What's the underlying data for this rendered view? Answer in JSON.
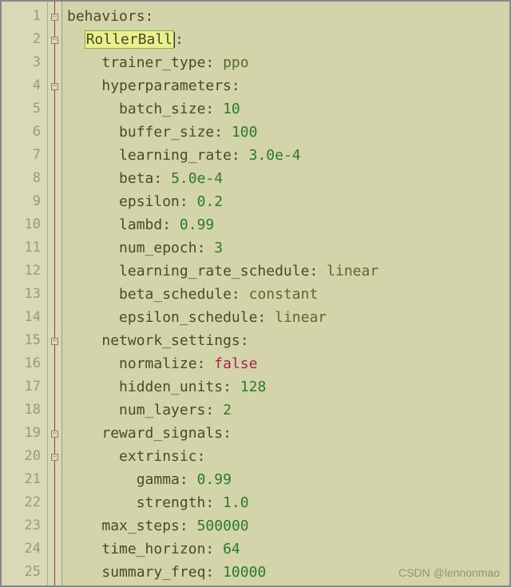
{
  "watermark": "CSDN @lennonmao",
  "lines": [
    {
      "n": 1,
      "indent": 0,
      "fold": "open",
      "key": "behaviors",
      "val": "",
      "type": "none"
    },
    {
      "n": 2,
      "indent": 1,
      "fold": "open",
      "key": "RollerBall",
      "hl": true,
      "cursor": true,
      "val": "",
      "type": "none"
    },
    {
      "n": 3,
      "indent": 2,
      "fold": "",
      "key": "trainer_type",
      "val": "ppo",
      "type": "str"
    },
    {
      "n": 4,
      "indent": 2,
      "fold": "open",
      "key": "hyperparameters",
      "val": "",
      "type": "none"
    },
    {
      "n": 5,
      "indent": 3,
      "fold": "",
      "key": "batch_size",
      "val": "10",
      "type": "num"
    },
    {
      "n": 6,
      "indent": 3,
      "fold": "",
      "key": "buffer_size",
      "val": "100",
      "type": "num"
    },
    {
      "n": 7,
      "indent": 3,
      "fold": "",
      "key": "learning_rate",
      "val": "3.0e-4",
      "type": "num"
    },
    {
      "n": 8,
      "indent": 3,
      "fold": "",
      "key": "beta",
      "val": "5.0e-4",
      "type": "num"
    },
    {
      "n": 9,
      "indent": 3,
      "fold": "",
      "key": "epsilon",
      "val": "0.2",
      "type": "num"
    },
    {
      "n": 10,
      "indent": 3,
      "fold": "",
      "key": "lambd",
      "val": "0.99",
      "type": "num"
    },
    {
      "n": 11,
      "indent": 3,
      "fold": "",
      "key": "num_epoch",
      "val": "3",
      "type": "num"
    },
    {
      "n": 12,
      "indent": 3,
      "fold": "",
      "key": "learning_rate_schedule",
      "val": "linear",
      "type": "str"
    },
    {
      "n": 13,
      "indent": 3,
      "fold": "",
      "key": "beta_schedule",
      "val": "constant",
      "type": "str"
    },
    {
      "n": 14,
      "indent": 3,
      "fold": "",
      "key": "epsilon_schedule",
      "val": "linear",
      "type": "str"
    },
    {
      "n": 15,
      "indent": 2,
      "fold": "open",
      "key": "network_settings",
      "val": "",
      "type": "none"
    },
    {
      "n": 16,
      "indent": 3,
      "fold": "",
      "key": "normalize",
      "val": "false",
      "type": "bool"
    },
    {
      "n": 17,
      "indent": 3,
      "fold": "",
      "key": "hidden_units",
      "val": "128",
      "type": "num"
    },
    {
      "n": 18,
      "indent": 3,
      "fold": "",
      "key": "num_layers",
      "val": "2",
      "type": "num"
    },
    {
      "n": 19,
      "indent": 2,
      "fold": "open",
      "key": "reward_signals",
      "val": "",
      "type": "none"
    },
    {
      "n": 20,
      "indent": 3,
      "fold": "open",
      "key": "extrinsic",
      "val": "",
      "type": "none"
    },
    {
      "n": 21,
      "indent": 4,
      "fold": "",
      "key": "gamma",
      "val": "0.99",
      "type": "num"
    },
    {
      "n": 22,
      "indent": 4,
      "fold": "",
      "key": "strength",
      "val": "1.0",
      "type": "num"
    },
    {
      "n": 23,
      "indent": 2,
      "fold": "",
      "key": "max_steps",
      "val": "500000",
      "type": "num"
    },
    {
      "n": 24,
      "indent": 2,
      "fold": "",
      "key": "time_horizon",
      "val": "64",
      "type": "num"
    },
    {
      "n": 25,
      "indent": 2,
      "fold": "",
      "key": "summary_freq",
      "val": "10000",
      "type": "num"
    }
  ]
}
